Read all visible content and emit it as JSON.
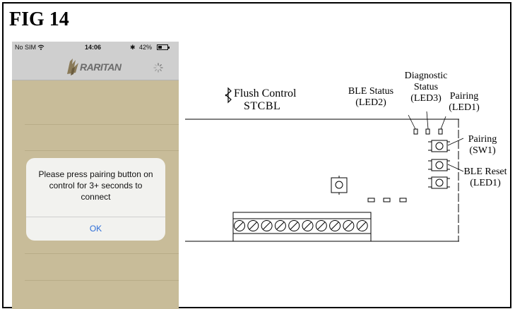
{
  "figure_label": "FIG 14",
  "phone": {
    "status": {
      "carrier": "No SIM",
      "time": "14:06",
      "bluetooth": "✱",
      "battery_text": "42%",
      "battery_level": 0.42
    },
    "app_logo_text": "RARITAN",
    "alert": {
      "message": "Please press pairing button on control for 3+ seconds to connect",
      "ok_label": "OK"
    }
  },
  "diagram": {
    "product_line1": "Flush Control",
    "product_line2": "STCBL",
    "ble_status": [
      "BLE Status",
      "(LED2)"
    ],
    "diagnostic_status": [
      "Diagnostic",
      "Status",
      "(LED3)"
    ],
    "pairing_led": [
      "Pairing",
      "(LED1)"
    ],
    "pairing_sw": [
      "Pairing",
      "(SW1)"
    ],
    "ble_reset": [
      "BLE Reset",
      "(LED1)"
    ]
  }
}
